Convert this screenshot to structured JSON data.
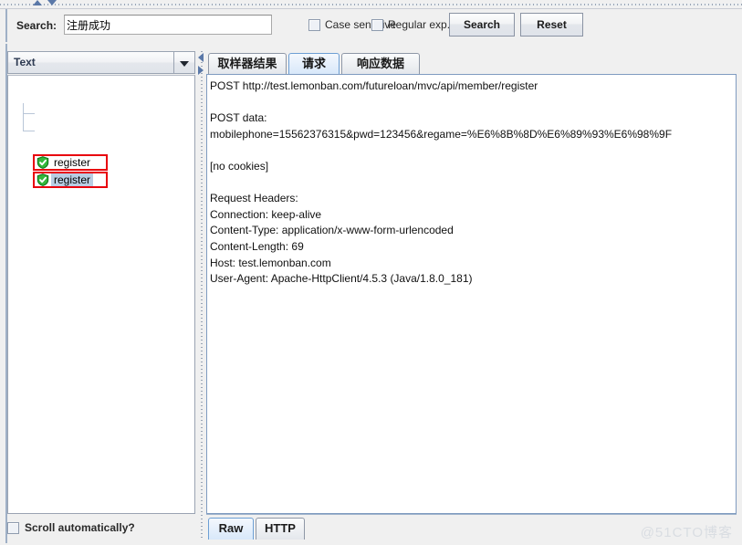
{
  "search_bar": {
    "label": "Search:",
    "query_value": "注册成功",
    "query_placeholder": "",
    "case_sensitive_label": "Case sensitive",
    "case_sensitive_checked": false,
    "regular_exp_label": "Regular exp.",
    "regular_exp_checked": false,
    "search_button": "Search",
    "reset_button": "Reset"
  },
  "left_panel": {
    "render_combo": {
      "selected": "Text",
      "options": [
        "Text"
      ]
    },
    "tree_items": [
      {
        "label": "register",
        "status": "success",
        "selected": false,
        "highlighted": true
      },
      {
        "label": "register",
        "status": "success",
        "selected": true,
        "highlighted": true
      }
    ],
    "scroll_automatically_label": "Scroll automatically?",
    "scroll_automatically_checked": false
  },
  "right_panel": {
    "tabs": [
      {
        "label": "取样器结果",
        "active": false
      },
      {
        "label": "请求",
        "active": true
      },
      {
        "label": "响应数据",
        "active": false
      }
    ],
    "request_text_lines": [
      "POST http://test.lemonban.com/futureloan/mvc/api/member/register",
      "",
      "POST data:",
      "mobilephone=15562376315&pwd=123456&regame=%E6%8B%8D%E6%89%93%E6%98%9F",
      "",
      "[no cookies]",
      "",
      "Request Headers:",
      "Connection: keep-alive",
      "Content-Type: application/x-www-form-urlencoded",
      "Content-Length: 69",
      "Host: test.lemonban.com",
      "User-Agent: Apache-HttpClient/4.5.3 (Java/1.8.0_181)"
    ],
    "bottom_tabs": [
      {
        "label": "Raw",
        "active": true
      },
      {
        "label": "HTTP",
        "active": false
      }
    ]
  },
  "watermark": "@51CTO博客",
  "colors": {
    "highlight_box": "#e8000d",
    "success_icon": "#22a02a",
    "selection": "#b9cde3",
    "active_tab": "#d8e8fa",
    "panel_bg": "#f0f0f0"
  }
}
